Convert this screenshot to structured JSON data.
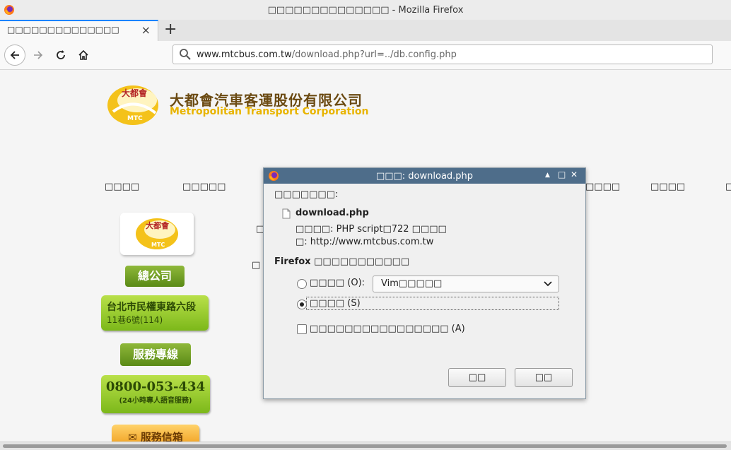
{
  "window": {
    "title": "□□□□□□□□□□□□□□ - Mozilla Firefox"
  },
  "tab": {
    "title": "□□□□□□□□□□□□□□",
    "close": "×",
    "new_tab": "+"
  },
  "nav": {
    "url_host": "www.mtcbus.com.tw",
    "url_path": "/download.php?url=../db.config.php"
  },
  "page": {
    "company_zh": "大都會汽車客運股份有限公司",
    "company_en": "Metropolitan Transport Corporation",
    "logo_text": "大都會",
    "logo_sub": "MTC",
    "menu": [
      "□□□□",
      "□□□□□",
      "□□□□",
      "□□□□",
      "□"
    ],
    "side": {
      "head_office": "總公司",
      "address_line1": "台北市民權東路六段",
      "address_line2": "11巷6號(114)",
      "service_line": "服務專線",
      "phone": "0800-053-434",
      "phone_note": "(24小時專人語音服務)",
      "mailbox": "服務信箱"
    },
    "partial_glyphs": [
      "□",
      "□"
    ]
  },
  "dialog": {
    "title": "□□□: download.php",
    "intro": "□□□□□□□:",
    "filename": "download.php",
    "type_label": "□□□□: PHP script□722 □□□□",
    "from_label": "□: http://www.mtcbus.com.tw",
    "question": "Firefox □□□□□□□□□□□",
    "open_with_label": "□□□□ (O):",
    "open_with_app": "Vim□□□□□",
    "save_label": "□□□□ (S)",
    "remember_label": "□□□□□□□□□□□□□□□□ (A)",
    "cancel": "□□",
    "ok": "□□",
    "ctl_min": "▲",
    "ctl_max": "□",
    "ctl_close": "✕"
  },
  "colors": {
    "accent": "#0a84ff",
    "dialog_title": "#4e6d8a",
    "brand_gold": "#e8b400",
    "brand_brown": "#6b4a12",
    "green": "#7cb81a"
  }
}
